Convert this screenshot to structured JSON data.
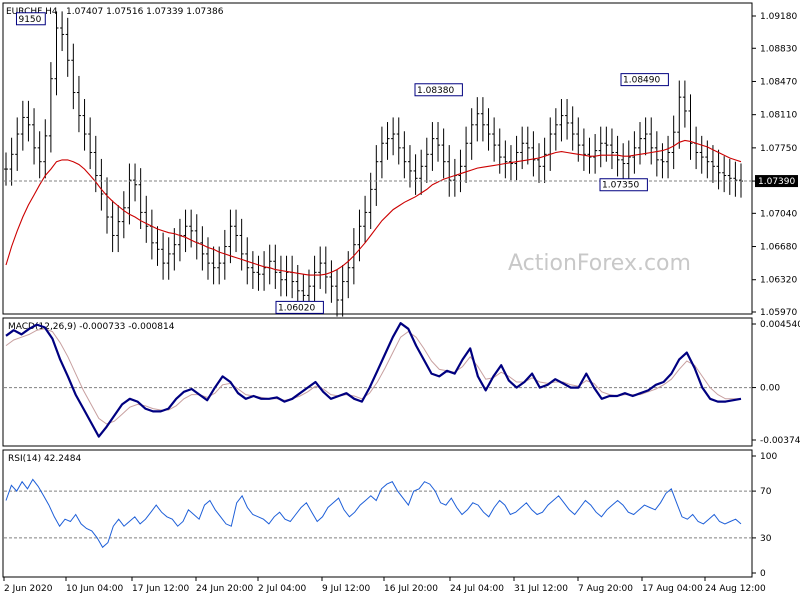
{
  "header": {
    "symbol": "EURCHF,H4",
    "ohlc": "1.07407 1.07516 1.07339 1.07386"
  },
  "watermark": "ActionForex.com",
  "colors": {
    "price_bars": "#000000",
    "moving_average": "#cc0000",
    "macd_line": "#000080",
    "macd_signal": "#c8a0a0",
    "rsi_line": "#1e5fd8",
    "grid_dash": "#808080",
    "label_border": "#000080"
  },
  "chart_data": [
    {
      "type": "candlestick",
      "panel": "price",
      "ylim": [
        1.0597,
        1.0918
      ],
      "y_ticks": [
        "1.09180",
        "1.08830",
        "1.08470",
        "1.08110",
        "1.07750",
        "1.07390",
        "1.07040",
        "1.06680",
        "1.06320",
        "1.05970"
      ],
      "current_price_label": "1.07390",
      "current_price": 1.0739,
      "annotations": [
        {
          "text": "9150",
          "value": 1.0915
        },
        {
          "text": "1.08380",
          "value": 1.0838
        },
        {
          "text": "1.08490",
          "value": 1.0849
        },
        {
          "text": "1.07350",
          "value": 1.0735
        },
        {
          "text": "1.06020",
          "value": 1.0602
        }
      ],
      "series": [
        {
          "values": [
            1.0752,
            1.0768,
            1.079,
            1.0808,
            1.08,
            1.0775,
            1.076,
            1.0788,
            1.085,
            1.0905,
            1.0898,
            1.087,
            1.0835,
            1.081,
            1.079,
            1.077,
            1.0745,
            1.0725,
            1.07,
            1.068,
            1.0695,
            1.071,
            1.074,
            1.0735,
            1.0705,
            1.069,
            1.0672,
            1.0665,
            1.065,
            1.066,
            1.067,
            1.068,
            1.069,
            1.0685,
            1.0672,
            1.066,
            1.065,
            1.0645,
            1.065,
            1.0668,
            1.069,
            1.068,
            1.066,
            1.0645,
            1.064,
            1.0638,
            1.0645,
            1.0652,
            1.064,
            1.0632,
            1.064,
            1.063,
            1.062,
            1.0615,
            1.0625,
            1.064,
            1.065,
            1.0635,
            1.0625,
            1.061,
            1.063,
            1.0645,
            1.067,
            1.069,
            1.0705,
            1.073,
            1.076,
            1.078,
            1.0785,
            1.079,
            1.0775,
            1.076,
            1.075,
            1.0742,
            1.0755,
            1.0768,
            1.0785,
            1.0778,
            1.076,
            1.074,
            1.0745,
            1.0755,
            1.078,
            1.08,
            1.0812,
            1.08,
            1.079,
            1.0778,
            1.0765,
            1.076,
            1.0758,
            1.077,
            1.078,
            1.0775,
            1.0762,
            1.0755,
            1.0768,
            1.079,
            1.08,
            1.081,
            1.0802,
            1.079,
            1.0778,
            1.0768,
            1.0765,
            1.0772,
            1.078,
            1.0778,
            1.077,
            1.0762,
            1.0758,
            1.0765,
            1.0775,
            1.0785,
            1.079,
            1.0775,
            1.0762,
            1.076,
            1.077,
            1.0792,
            1.083,
            1.0815,
            1.078,
            1.077,
            1.0765,
            1.076,
            1.0755,
            1.0748,
            1.0745,
            1.0742,
            1.074,
            1.0739
          ],
          "ma": [
            1.0648,
            1.0668,
            1.0685,
            1.07,
            1.0713,
            1.0724,
            1.0735,
            1.0745,
            1.0752,
            1.076,
            1.0762,
            1.0762,
            1.076,
            1.0757,
            1.0752,
            1.0745,
            1.0738,
            1.073,
            1.0723,
            1.0717,
            1.0712,
            1.0707,
            1.0703,
            1.07,
            1.0696,
            1.0693,
            1.069,
            1.0687,
            1.0685,
            1.0683,
            1.0682,
            1.068,
            1.0678,
            1.0675,
            1.0672,
            1.067,
            1.0667,
            1.0665,
            1.0662,
            1.066,
            1.0658,
            1.0656,
            1.0654,
            1.0652,
            1.065,
            1.0648,
            1.0646,
            1.0645,
            1.0643,
            1.0642,
            1.0641,
            1.064,
            1.0639,
            1.0638,
            1.0637,
            1.0637,
            1.0637,
            1.0638,
            1.064,
            1.0643,
            1.0647,
            1.0652,
            1.0658,
            1.0665,
            1.0672,
            1.068,
            1.0688,
            1.0696,
            1.0702,
            1.0708,
            1.0712,
            1.0716,
            1.0719,
            1.0722,
            1.0726,
            1.073,
            1.0735,
            1.0738,
            1.0741,
            1.0743,
            1.0745,
            1.0747,
            1.0749,
            1.0751,
            1.0753,
            1.0754,
            1.0755,
            1.0756,
            1.0757,
            1.0758,
            1.0759,
            1.076,
            1.0761,
            1.0762,
            1.0763,
            1.0764,
            1.0766,
            1.0768,
            1.077,
            1.0771,
            1.077,
            1.0769,
            1.0768,
            1.0767,
            1.0766,
            1.0766,
            1.0767,
            1.0767,
            1.0767,
            1.0767,
            1.0766,
            1.0766,
            1.0767,
            1.0768,
            1.0769,
            1.077,
            1.0771,
            1.0772,
            1.0774,
            1.0777,
            1.0781,
            1.0783,
            1.0782,
            1.078,
            1.0778,
            1.0776,
            1.0773,
            1.077,
            1.0767,
            1.0764,
            1.0762,
            1.076
          ]
        }
      ]
    },
    {
      "type": "line",
      "panel": "macd",
      "title": "MACD(12,26,9) -0.000733 -0.000814",
      "ylim": [
        -0.003745,
        0.00454
      ],
      "y_ticks": [
        "0.004540",
        "0.00",
        "-0.003745"
      ],
      "series": [
        {
          "values": [
            0.0037,
            0.0041,
            0.0038,
            0.0042,
            0.0045,
            0.0043,
            0.0035,
            0.002,
            0.0008,
            -0.0005,
            -0.0015,
            -0.0025,
            -0.0035,
            -0.0028,
            -0.002,
            -0.0012,
            -0.0008,
            -0.001,
            -0.0015,
            -0.0017,
            -0.0017,
            -0.0015,
            -0.0008,
            -0.0003,
            -0.0001,
            -0.0005,
            -0.0009,
            0.0,
            0.0008,
            0.0004,
            -0.0004,
            -0.0008,
            -0.0006,
            -0.0008,
            -0.0008,
            -0.0007,
            -0.001,
            -0.0008,
            -0.0004,
            0.0,
            0.0004,
            -0.0003,
            -0.0008,
            -0.0006,
            -0.0004,
            -0.0008,
            -0.001,
            0.0,
            0.0012,
            0.0024,
            0.0036,
            0.0046,
            0.0042,
            0.003,
            0.002,
            0.001,
            0.0008,
            0.0012,
            0.001,
            0.002,
            0.0028,
            0.0008,
            -0.0002,
            0.0008,
            0.0016,
            0.0005,
            0.0,
            0.0004,
            0.001,
            0.0,
            0.0002,
            0.0006,
            0.0003,
            0.0,
            0.0,
            0.001,
            0.0,
            -0.0008,
            -0.0006,
            -0.0006,
            -0.0004,
            -0.0006,
            -0.0004,
            -0.0002,
            0.0002,
            0.0004,
            0.001,
            0.002,
            0.0025,
            0.0014,
            0.0,
            -0.0008,
            -0.001,
            -0.001,
            -0.0009,
            -0.0008
          ]
        },
        {
          "values": [
            0.003,
            0.0034,
            0.0036,
            0.0038,
            0.0041,
            0.0042,
            0.004,
            0.0032,
            0.0022,
            0.001,
            -0.0002,
            -0.0012,
            -0.0022,
            -0.0026,
            -0.0024,
            -0.0019,
            -0.0014,
            -0.0012,
            -0.0013,
            -0.0015,
            -0.0016,
            -0.0016,
            -0.0013,
            -0.0008,
            -0.0005,
            -0.0005,
            -0.0007,
            -0.0004,
            0.0002,
            0.0003,
            -0.0001,
            -0.0005,
            -0.0006,
            -0.0007,
            -0.0008,
            -0.0008,
            -0.0009,
            -0.0008,
            -0.0006,
            -0.0003,
            0.0001,
            -0.0001,
            -0.0005,
            -0.0006,
            -0.0005,
            -0.0006,
            -0.0008,
            -0.0004,
            0.0004,
            0.0014,
            0.0025,
            0.0036,
            0.004,
            0.0036,
            0.0028,
            0.0019,
            0.0013,
            0.0012,
            0.0011,
            0.0015,
            0.0022,
            0.0015,
            0.0006,
            0.0007,
            0.0011,
            0.0008,
            0.0004,
            0.0004,
            0.0007,
            0.0004,
            0.0003,
            0.0004,
            0.0004,
            0.0002,
            0.0001,
            0.0005,
            0.0003,
            -0.0003,
            -0.0005,
            -0.0006,
            -0.0005,
            -0.0005,
            -0.0005,
            -0.0003,
            -0.0001,
            0.0002,
            0.0006,
            0.0013,
            0.0019,
            0.0016,
            0.0008,
            0.0,
            -0.0005,
            -0.0008,
            -0.0008,
            -0.0008
          ]
        }
      ]
    },
    {
      "type": "line",
      "panel": "rsi",
      "title": "RSI(14) 42.2484",
      "ylim": [
        0,
        100
      ],
      "y_ticks": [
        "100",
        "70",
        "30",
        "0"
      ],
      "reference_lines": [
        70,
        30
      ],
      "series": [
        {
          "values": [
            62,
            75,
            70,
            78,
            72,
            80,
            74,
            66,
            58,
            48,
            40,
            46,
            44,
            50,
            42,
            38,
            36,
            30,
            22,
            26,
            40,
            46,
            40,
            44,
            48,
            42,
            46,
            52,
            58,
            52,
            48,
            46,
            40,
            44,
            54,
            50,
            46,
            58,
            62,
            54,
            48,
            42,
            40,
            60,
            66,
            56,
            50,
            48,
            46,
            42,
            48,
            52,
            46,
            44,
            50,
            56,
            60,
            52,
            44,
            48,
            56,
            60,
            64,
            54,
            48,
            52,
            58,
            62,
            66,
            62,
            72,
            76,
            78,
            70,
            64,
            58,
            70,
            72,
            78,
            76,
            70,
            60,
            58,
            64,
            56,
            50,
            54,
            60,
            58,
            52,
            48,
            56,
            62,
            58,
            50,
            52,
            56,
            60,
            54,
            50,
            52,
            58,
            62,
            66,
            60,
            54,
            50,
            56,
            62,
            58,
            52,
            48,
            54,
            58,
            62,
            58,
            52,
            50,
            54,
            58,
            56,
            54,
            60,
            68,
            72,
            60,
            48,
            46,
            50,
            44,
            42,
            46,
            50,
            44,
            42,
            44,
            46,
            42
          ]
        }
      ]
    }
  ],
  "x_labels": [
    "2 Jun 2020",
    "10 Jun 04:00",
    "17 Jun 12:00",
    "24 Jun 20:00",
    "2 Jul 04:00",
    "9 Jul 12:00",
    "16 Jul 20:00",
    "24 Jul 04:00",
    "31 Jul 12:00",
    "7 Aug 20:00",
    "17 Aug 04:00",
    "24 Aug 12:00"
  ]
}
